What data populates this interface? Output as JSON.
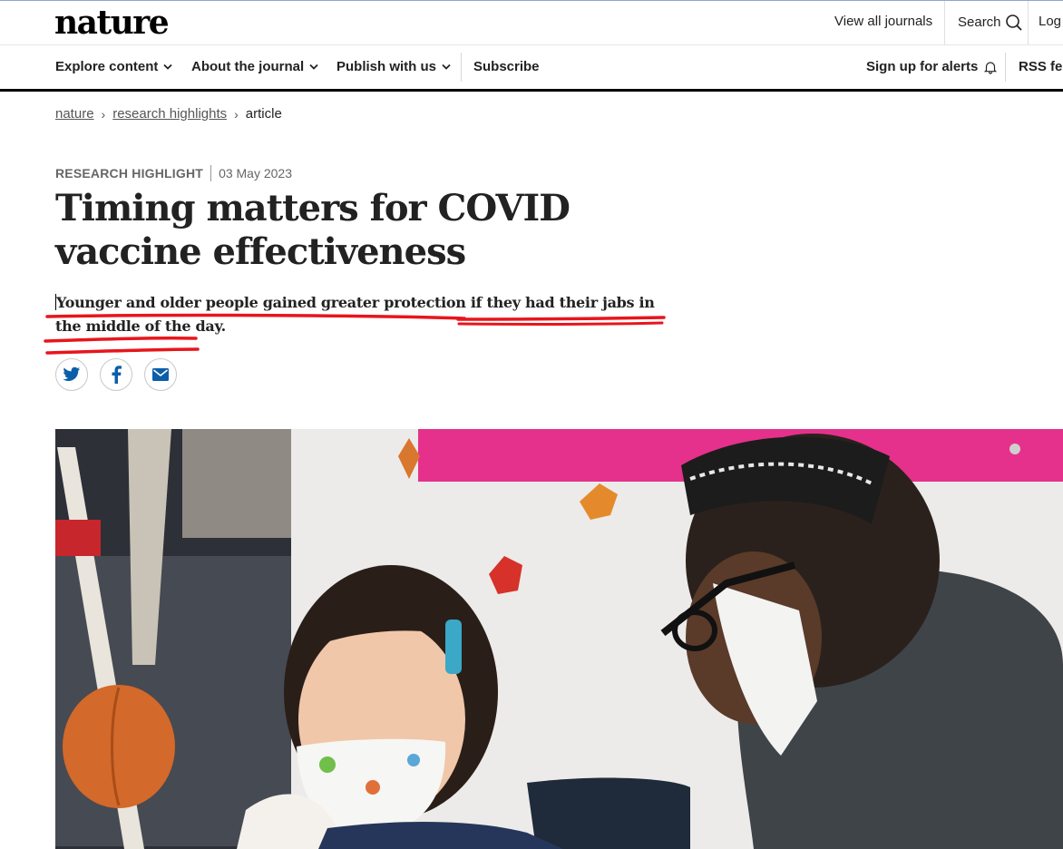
{
  "site": {
    "logo": "nature"
  },
  "header": {
    "view_all_journals": "View all journals",
    "search": "Search",
    "login": "Log"
  },
  "nav": {
    "explore": "Explore content",
    "about": "About the journal",
    "publish": "Publish with us",
    "subscribe": "Subscribe",
    "alerts": "Sign up for alerts",
    "rss": "RSS fee"
  },
  "breadcrumb": {
    "items": [
      "nature",
      "research highlights",
      "article"
    ]
  },
  "article": {
    "type": "RESEARCH HIGHLIGHT",
    "date": "03 May 2023",
    "title": "Timing matters for COVID vaccine effectiveness",
    "standfirst": "Younger and older people gained greater protection if they had their jabs in the middle of the day."
  },
  "share": {
    "icons": [
      "twitter-icon",
      "facebook-icon",
      "email-icon"
    ]
  },
  "colors": {
    "annotation_red": "#e8151b",
    "nav_border": "#000000",
    "magenta_banner": "#e5318c"
  }
}
